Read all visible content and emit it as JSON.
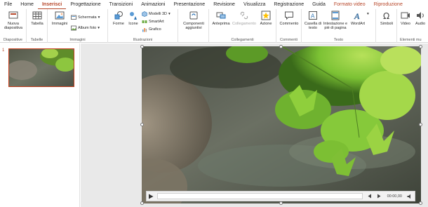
{
  "menu": {
    "tabs": [
      {
        "label": "File",
        "state": "normal"
      },
      {
        "label": "Home",
        "state": "normal"
      },
      {
        "label": "Inserisci",
        "state": "active"
      },
      {
        "label": "Progettazione",
        "state": "normal"
      },
      {
        "label": "Transizioni",
        "state": "normal"
      },
      {
        "label": "Animazioni",
        "state": "normal"
      },
      {
        "label": "Presentazione",
        "state": "normal"
      },
      {
        "label": "Revisione",
        "state": "normal"
      },
      {
        "label": "Visualizza",
        "state": "normal"
      },
      {
        "label": "Registrazione",
        "state": "normal"
      },
      {
        "label": "Guida",
        "state": "normal"
      },
      {
        "label": "Formato video",
        "state": "contextual"
      },
      {
        "label": "Riproduzione",
        "state": "contextual"
      }
    ]
  },
  "ribbon": {
    "groups": {
      "diapositive": "Diapositive",
      "tabelle": "Tabelle",
      "immagini": "Immagini",
      "illustrazioni": "Illustrazioni",
      "collegamenti": "Collegamenti",
      "commenti": "Commenti",
      "testo": "Testo",
      "elementi": "Elementi mu"
    },
    "buttons": {
      "nuova_diapositiva": "Nuova diapositiva",
      "tabella": "Tabella",
      "immagini": "Immagini",
      "schermata": "Schermata",
      "album_foto": "Album foto",
      "forme": "Forme",
      "icone": "Icone",
      "modelli_3d": "Modelli 3D",
      "smartart": "SmartArt",
      "grafico": "Grafico",
      "componenti_aggiuntivi": "Componenti aggiuntivi",
      "anteprima": "Anteprima",
      "collegamento": "Collegamento",
      "azione": "Azione",
      "commento": "Commento",
      "casella_di_testo": "Casella di testo",
      "intestazione": "Intestazione e piè di pagina",
      "wordart": "WordArt",
      "simboli": "Simboli",
      "video": "Video",
      "audio": "Audio"
    }
  },
  "thumbnails": {
    "slide_number": "1"
  },
  "video_player": {
    "time": "00:00,00"
  },
  "colors": {
    "accent": "#b7472a",
    "selection_border": "#c43e1c",
    "leaf_green": "#7cc234",
    "dark_green": "#3a6a1a"
  }
}
